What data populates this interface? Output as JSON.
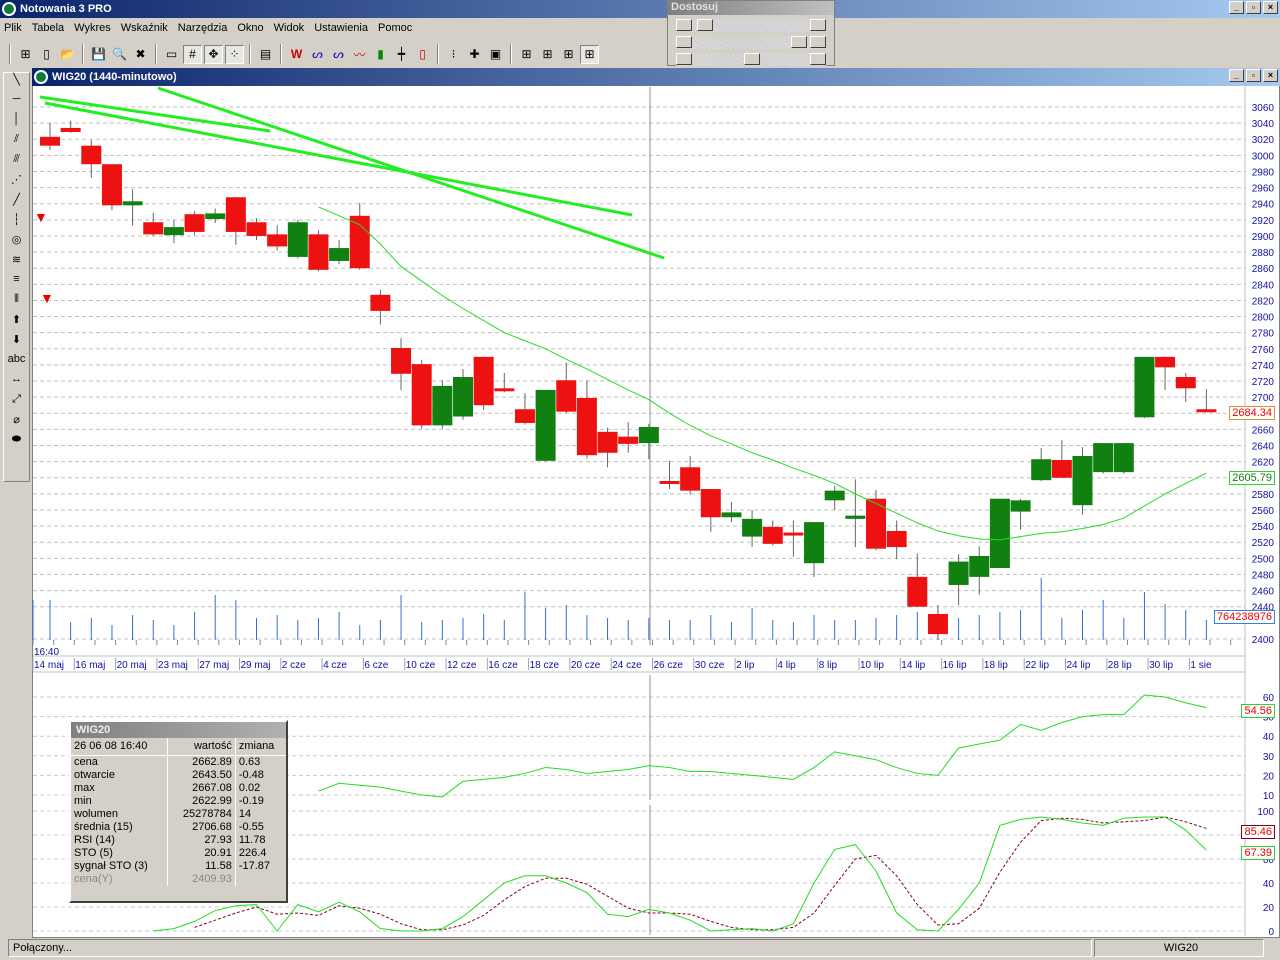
{
  "app": {
    "title": "Notowania 3 PRO"
  },
  "menu": [
    "Plik",
    "Tabela",
    "Wykres",
    "Wskaźnik",
    "Narzędzia",
    "Okno",
    "Widok",
    "Ustawienia",
    "Pomoc"
  ],
  "toolbar_icons": [
    "layout-icon",
    "new-file-icon",
    "open-folder-icon",
    "save-icon",
    "zoom-icon",
    "delete-icon",
    "ruler-icon",
    "numbers-icon",
    "move-icon",
    "dots-icon",
    "window-icon",
    "wl-icon",
    "wave-icon",
    "wave2-icon",
    "line-chart-icon",
    "bar-chart-icon",
    "ohlc-icon",
    "candle-icon",
    "traffic-light-icon",
    "add-marker-icon",
    "add-window-icon",
    "grid1-icon",
    "grid2-icon",
    "grid3-icon",
    "grid4-icon"
  ],
  "dostosuj": {
    "title": "Dostosuj",
    "sliders": [
      0.05,
      0.95,
      0.5
    ]
  },
  "left_tools": [
    "╲",
    "─",
    "│",
    "⫽",
    "⫻",
    "⋰",
    "╱",
    "┆",
    "◎",
    "≋",
    "≡",
    "⦀",
    "⬆",
    "⬇",
    "abc",
    "↔",
    "⤢",
    "⌀",
    "⬬"
  ],
  "chart": {
    "window_title": "WIG20 (1440-minutowo)",
    "time_label": "16:40"
  },
  "value_boxes": {
    "price": "2684.34",
    "ma": "2605.79",
    "volume": "764238976",
    "rsi": "54.56",
    "sto_signal": "85.46",
    "sto": "67.39"
  },
  "info": {
    "title": "WIG20",
    "datetime": "26 06 08 16:40",
    "col_value": "wartość",
    "col_change": "zmiana",
    "rows": [
      [
        "cena",
        "2662.89",
        "0.63"
      ],
      [
        "otwarcie",
        "2643.50",
        "-0.48"
      ],
      [
        "max",
        "2667.08",
        "0.02"
      ],
      [
        "min",
        "2622.99",
        "-0.19"
      ],
      [
        "wolumen",
        "25278784",
        "14"
      ],
      [
        "średnia (15)",
        "2706.68",
        "-0.55"
      ],
      [
        "RSI (14)",
        "27.93",
        "11.78"
      ],
      [
        "STO (5)",
        "20.91",
        "226.4"
      ],
      [
        "sygnał STO (3)",
        "11.58",
        "-17.87"
      ]
    ],
    "muted_row": [
      "cena(Y)",
      "2409.93"
    ]
  },
  "status": {
    "left": "Połączony...",
    "right": "WIG20"
  },
  "colors": {
    "up": "#108010",
    "down": "#ee1111",
    "ma": "#22dd22",
    "trend": "#22ee22",
    "volume": "#3070d0",
    "axis_text": "#1010a0",
    "signal": "#800020"
  },
  "chart_data": {
    "type": "candlestick",
    "price_ylim": [
      2400,
      3060
    ],
    "price_ticks": [
      3060,
      3040,
      3020,
      3000,
      2980,
      2960,
      2940,
      2920,
      2900,
      2880,
      2860,
      2840,
      2820,
      2800,
      2780,
      2760,
      2740,
      2720,
      2700,
      2680,
      2660,
      2640,
      2620,
      2600,
      2580,
      2560,
      2540,
      2520,
      2500,
      2480,
      2460,
      2440,
      2400
    ],
    "date_labels": [
      "14 maj",
      "16 maj",
      "20 maj",
      "23 maj",
      "27 maj",
      "29 maj",
      "2 cze",
      "4 cze",
      "6 cze",
      "10 cze",
      "12 cze",
      "16 cze",
      "18 cze",
      "20 cze",
      "24 cze",
      "26 cze",
      "30 cze",
      "2 lip",
      "4 lip",
      "8 lip",
      "10 lip",
      "14 lip",
      "16 lip",
      "18 lip",
      "22 lip",
      "24 lip",
      "28 lip",
      "30 lip",
      "1 sie"
    ],
    "ohlc": [
      [
        3023,
        3040,
        3007,
        3012
      ],
      [
        3034,
        3043,
        3028,
        3029
      ],
      [
        3012,
        3019,
        2972,
        2989
      ],
      [
        2989,
        2989,
        2932,
        2938
      ],
      [
        2938,
        2958,
        2913,
        2943
      ],
      [
        2917,
        2929,
        2900,
        2902
      ],
      [
        2901,
        2920,
        2891,
        2911
      ],
      [
        2927,
        2931,
        2901,
        2905
      ],
      [
        2921,
        2934,
        2916,
        2928
      ],
      [
        2948,
        2948,
        2889,
        2905
      ],
      [
        2917,
        2922,
        2895,
        2900
      ],
      [
        2902,
        2913,
        2882,
        2887
      ],
      [
        2874,
        2920,
        2872,
        2917
      ],
      [
        2902,
        2907,
        2856,
        2858
      ],
      [
        2869,
        2895,
        2865,
        2885
      ],
      [
        2925,
        2941,
        2858,
        2860
      ],
      [
        2827,
        2833,
        2790,
        2807
      ],
      [
        2761,
        2773,
        2709,
        2729
      ],
      [
        2741,
        2746,
        2661,
        2665
      ],
      [
        2665,
        2721,
        2661,
        2714
      ],
      [
        2676,
        2735,
        2672,
        2725
      ],
      [
        2750,
        2750,
        2684,
        2690
      ],
      [
        2711,
        2730,
        2706,
        2710
      ],
      [
        2685,
        2705,
        2666,
        2668
      ],
      [
        2621,
        2709,
        2620,
        2709
      ],
      [
        2721,
        2743,
        2680,
        2682
      ],
      [
        2699,
        2721,
        2624,
        2628
      ],
      [
        2657,
        2662,
        2613,
        2631
      ],
      [
        2651,
        2669,
        2631,
        2642
      ],
      [
        2643,
        2667,
        2623,
        2663
      ],
      [
        2596,
        2621,
        2586,
        2593
      ],
      [
        2613,
        2627,
        2579,
        2584
      ],
      [
        2586,
        2586,
        2533,
        2551
      ],
      [
        2551,
        2570,
        2545,
        2557
      ],
      [
        2527,
        2560,
        2514,
        2549
      ],
      [
        2539,
        2547,
        2516,
        2518
      ],
      [
        2532,
        2547,
        2502,
        2531
      ],
      [
        2494,
        2545,
        2477,
        2545
      ],
      [
        2572,
        2590,
        2560,
        2584
      ],
      [
        2549,
        2598,
        2514,
        2553
      ],
      [
        2574,
        2585,
        2510,
        2512
      ],
      [
        2534,
        2547,
        2499,
        2514
      ],
      [
        2477,
        2506,
        2440,
        2440
      ],
      [
        2431,
        2442,
        2401,
        2406
      ],
      [
        2467,
        2505,
        2442,
        2496
      ],
      [
        2477,
        2515,
        2455,
        2503
      ],
      [
        2488,
        2574,
        2488,
        2574
      ],
      [
        2558,
        2574,
        2536,
        2572
      ],
      [
        2597,
        2637,
        2596,
        2623
      ],
      [
        2622,
        2647,
        2600,
        2600
      ],
      [
        2566,
        2638,
        2554,
        2627
      ],
      [
        2607,
        2643,
        2605,
        2643
      ],
      [
        2607,
        2643,
        2605,
        2643
      ],
      [
        2675,
        2750,
        2674,
        2750
      ],
      [
        2750,
        2750,
        2709,
        2737
      ],
      [
        2725,
        2730,
        2694,
        2711
      ],
      [
        2685,
        2710,
        2682,
        2684.34
      ]
    ],
    "ma15_start_index": 13,
    "ma15": [
      2936,
      2925,
      2914,
      2890,
      2862,
      2844,
      2826,
      2810,
      2795,
      2780,
      2770,
      2760,
      2747,
      2735,
      2722,
      2709,
      2697,
      2680,
      2665,
      2652,
      2642,
      2631,
      2622,
      2612,
      2603,
      2593,
      2580,
      2568,
      2556,
      2544,
      2534,
      2528,
      2524,
      2523,
      2527,
      2531,
      2533,
      2537,
      2542,
      2550,
      2565,
      2580,
      2593,
      2605.79
    ],
    "volume_mln": [
      1528,
      688,
      840,
      573,
      955,
      764,
      573,
      1070,
      1719,
      1528,
      840,
      955,
      764,
      840,
      1070,
      573,
      764,
      1719,
      688,
      764,
      840,
      993,
      764,
      1834,
      1222,
      1337,
      955,
      840,
      764,
      840,
      764,
      764,
      955,
      688,
      1222,
      764,
      688,
      955,
      764,
      764,
      840,
      955,
      1070,
      1146,
      840,
      955,
      1070,
      1146,
      2368,
      840,
      1146,
      1528,
      840,
      1834,
      1375,
      1146,
      764
    ],
    "rsi": {
      "name": "RSI (14)",
      "ylim": [
        0,
        65
      ],
      "ticks": [
        60,
        50,
        40,
        30,
        20,
        10
      ],
      "start_index": 13,
      "values": [
        12,
        16,
        15,
        14,
        12,
        10,
        9,
        17,
        18,
        19,
        21,
        24,
        23,
        21,
        22,
        23,
        25,
        24,
        22,
        22,
        21,
        20,
        19,
        18,
        24,
        32,
        30,
        28,
        24,
        21,
        20,
        34,
        36,
        38,
        46,
        43,
        47,
        50,
        51,
        51,
        61,
        60,
        57,
        54.56
      ]
    },
    "sto": {
      "name": "STO (5)",
      "ylim": [
        0,
        100
      ],
      "ticks": [
        100,
        80,
        60,
        40,
        20,
        0
      ],
      "start_index": 5,
      "values": [
        0,
        2,
        8,
        17,
        21,
        22,
        0,
        22,
        16,
        24,
        16,
        2,
        0,
        0,
        2,
        12,
        26,
        40,
        46,
        46,
        40,
        32,
        14,
        12,
        18,
        15,
        9,
        0,
        1,
        2,
        0,
        6,
        40,
        68,
        72,
        50,
        15,
        1,
        0,
        18,
        40,
        88,
        93,
        95,
        93,
        90,
        88,
        94,
        95,
        95,
        84,
        67.39
      ],
      "signal_start_index": 7,
      "signal": [
        3,
        9,
        15,
        20,
        14,
        15,
        13,
        21,
        19,
        14,
        6,
        1,
        1,
        5,
        13,
        26,
        37,
        44,
        44,
        39,
        29,
        19,
        15,
        15,
        14,
        8,
        3,
        1,
        1,
        3,
        15,
        38,
        60,
        63,
        46,
        22,
        5,
        6,
        19,
        49,
        74,
        92,
        94,
        93,
        90,
        91,
        92,
        95,
        91,
        85.46
      ]
    }
  }
}
